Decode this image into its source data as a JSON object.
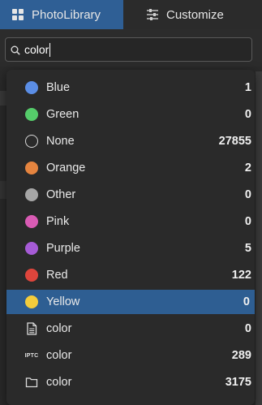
{
  "tabs": [
    {
      "label": "PhotoLibrary",
      "icon": "grid-icon",
      "active": true
    },
    {
      "label": "Customize",
      "icon": "sliders-icon",
      "active": false
    }
  ],
  "search": {
    "value": "color",
    "icon": "search-icon"
  },
  "items": [
    {
      "label": "Blue",
      "count": "1",
      "color": "#5b8ee6",
      "kind": "dot"
    },
    {
      "label": "Green",
      "count": "0",
      "color": "#55cc6a",
      "kind": "dot"
    },
    {
      "label": "None",
      "count": "27855",
      "color": "transparent",
      "kind": "ring"
    },
    {
      "label": "Orange",
      "count": "2",
      "color": "#e5843f",
      "kind": "dot"
    },
    {
      "label": "Other",
      "count": "0",
      "color": "#a6a6a6",
      "kind": "dot"
    },
    {
      "label": "Pink",
      "count": "0",
      "color": "#d95bb4",
      "kind": "dot"
    },
    {
      "label": "Purple",
      "count": "5",
      "color": "#a65bd6",
      "kind": "dot"
    },
    {
      "label": "Red",
      "count": "122",
      "color": "#de453c",
      "kind": "dot"
    },
    {
      "label": "Yellow",
      "count": "0",
      "color": "#f3cc3c",
      "kind": "dot",
      "selected": true
    },
    {
      "label": "color",
      "count": "0",
      "icon": "document-icon",
      "kind": "icon"
    },
    {
      "label": "color",
      "count": "289",
      "icon": "iptc-icon",
      "kind": "icon",
      "icon_text": "IPTC"
    },
    {
      "label": "color",
      "count": "3175",
      "icon": "folder-icon",
      "kind": "icon"
    }
  ],
  "colors": {
    "accent": "#2f5f95",
    "selected_row": "#2e5e92",
    "background": "#2a2a2a"
  }
}
